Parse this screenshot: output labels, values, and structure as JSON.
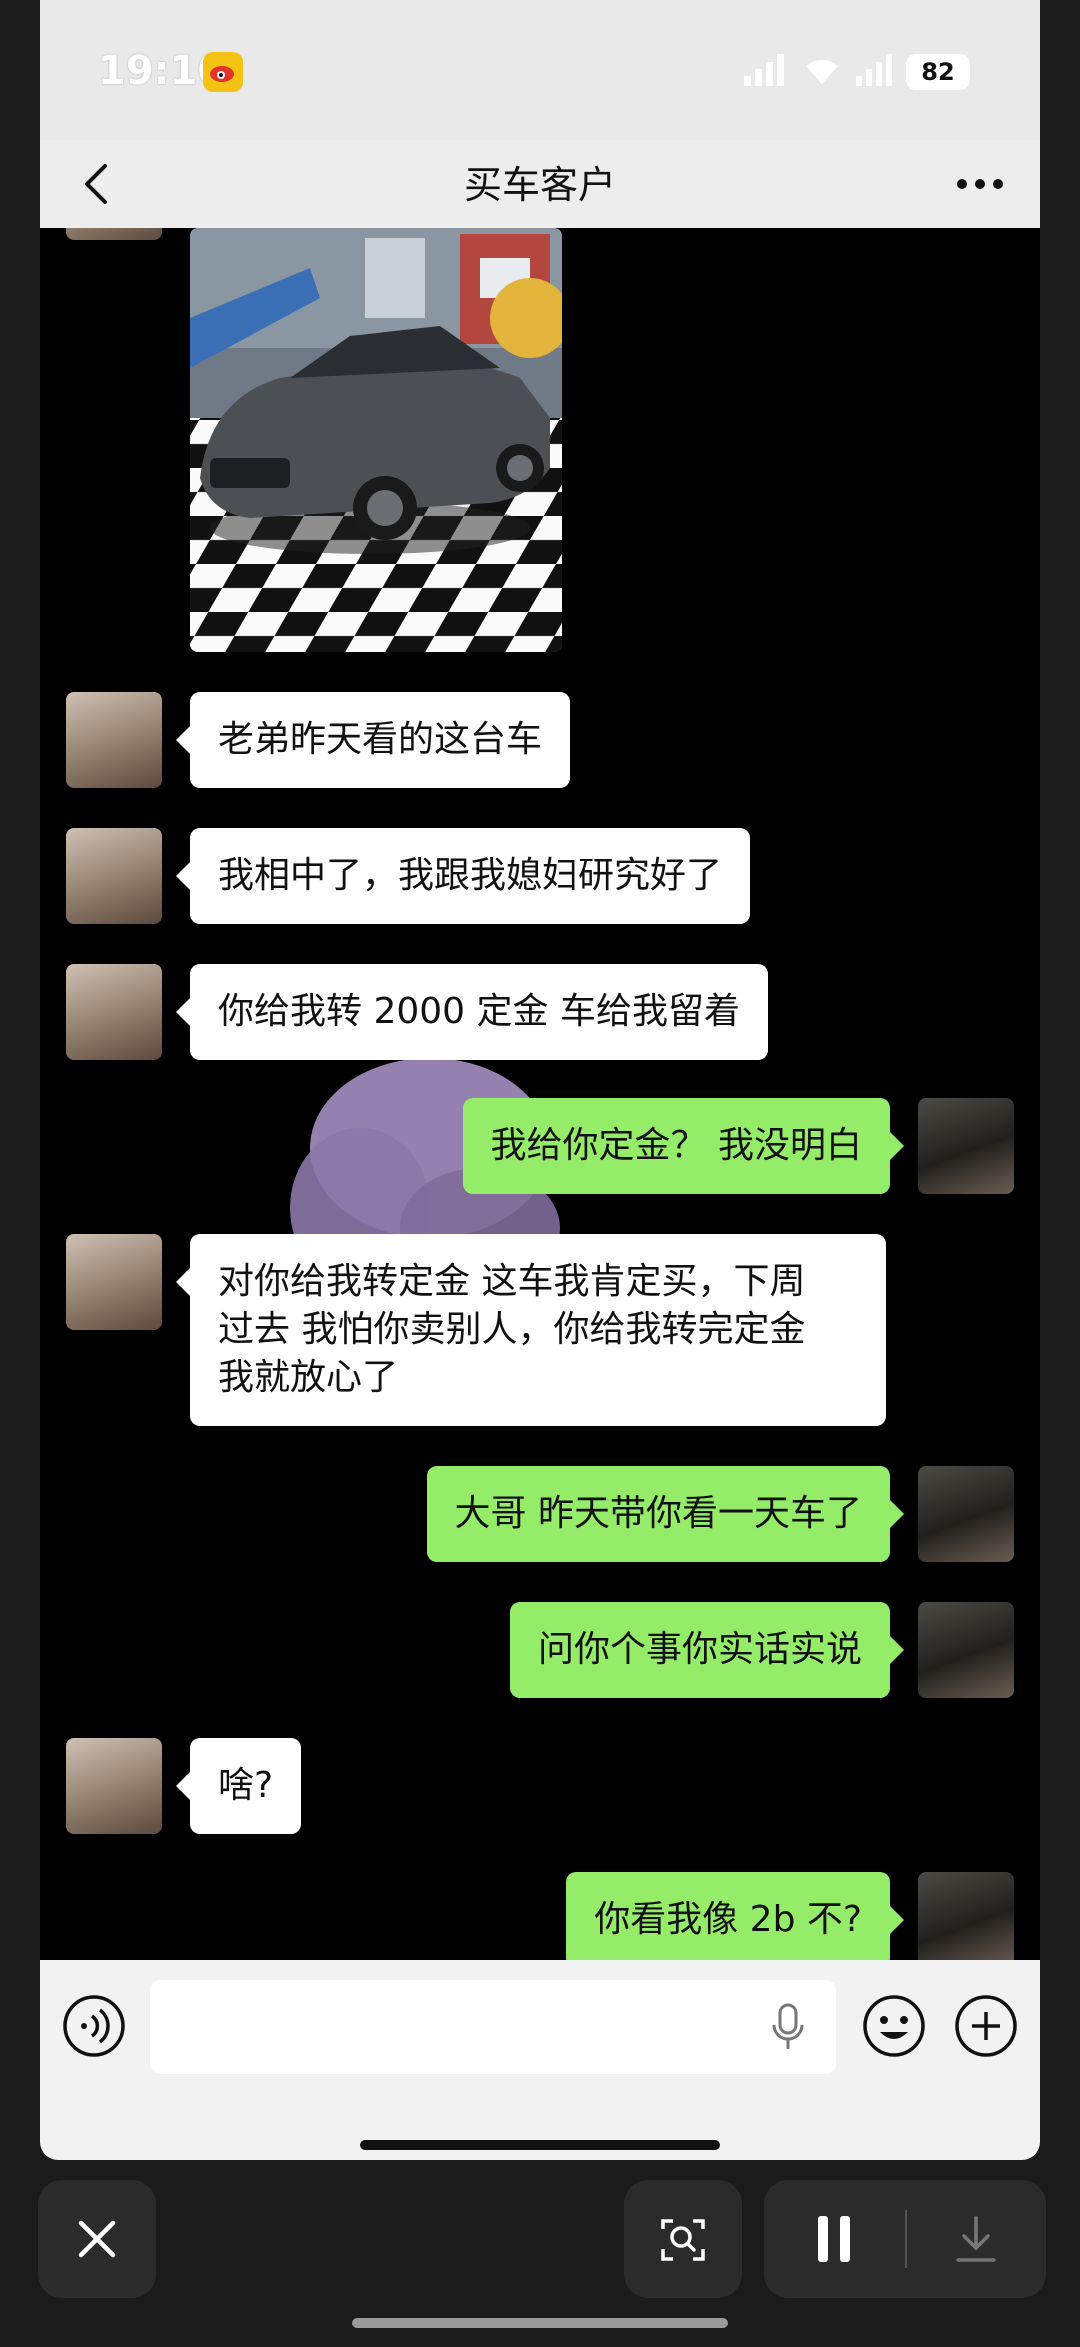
{
  "status_bar": {
    "time": "19:10",
    "battery": "82"
  },
  "header": {
    "title": "买车客户"
  },
  "messages": [
    {
      "side": "in",
      "text": "老弟昨天看的这台车"
    },
    {
      "side": "in",
      "text": "我相中了，我跟我媳妇研究好了"
    },
    {
      "side": "in",
      "text": "你给我转 2000 定金 车给我留着"
    },
    {
      "side": "out",
      "text": "我给你定金？ 我没明白"
    },
    {
      "side": "in",
      "lines": [
        "对你给我转定金 这车我肯定买，下周",
        "过去 我怕你卖别人，你给我转完定金",
        "我就放心了"
      ]
    },
    {
      "side": "out",
      "text": "大哥 昨天带你看一天车了"
    },
    {
      "side": "out",
      "text": "问你个事你实话实说"
    },
    {
      "side": "in",
      "text": "啥?"
    },
    {
      "side": "out",
      "text": "你看我像 2b 不?"
    }
  ],
  "icons": {
    "back": "chevron-left-icon",
    "more": "more-dots-icon",
    "voice": "voice-icon",
    "mic": "mic-icon",
    "emoji": "emoji-icon",
    "plus": "plus-icon",
    "close": "close-icon",
    "scan": "screen-scan-icon",
    "pause": "pause-icon",
    "download": "download-icon"
  },
  "colors": {
    "outgoing_bubble": "#95ec69",
    "incoming_bubble": "#ffffff",
    "chat_background": "#000000",
    "header_background": "#ededed"
  }
}
